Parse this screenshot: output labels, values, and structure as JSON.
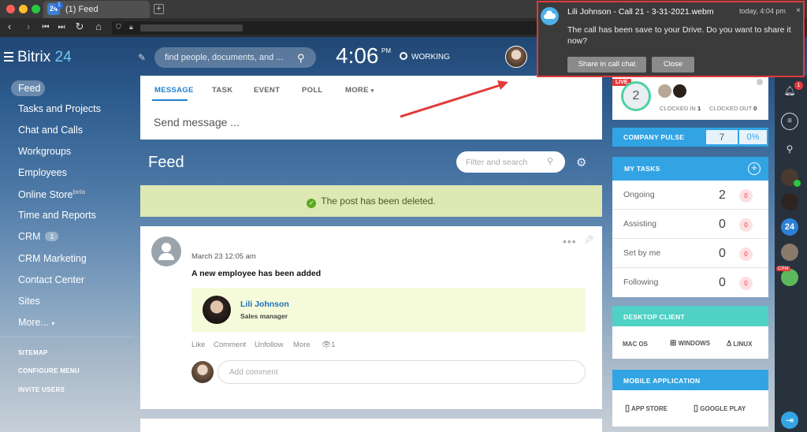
{
  "browser": {
    "tab_title": "(1) Feed",
    "tab_favicon_text": "24",
    "tab_badge": "1",
    "new_tab": "+"
  },
  "header": {
    "logo_main": "Bitrix",
    "logo_num": "24",
    "search_placeholder": "find people, documents, and ...",
    "clock": "4:06",
    "clock_pm": "PM",
    "status": "WORKING"
  },
  "sidebar": {
    "items": [
      {
        "label": "Feed"
      },
      {
        "label": "Tasks and Projects"
      },
      {
        "label": "Chat and Calls"
      },
      {
        "label": "Workgroups"
      },
      {
        "label": "Employees"
      },
      {
        "label": "Online Store",
        "sup": "beta"
      },
      {
        "label": "Time and Reports"
      },
      {
        "label": "CRM",
        "badge": "1"
      },
      {
        "label": "CRM Marketing"
      },
      {
        "label": "Contact Center"
      },
      {
        "label": "Sites"
      },
      {
        "label": "More..."
      }
    ],
    "small_links": [
      "SITEMAP",
      "CONFIGURE MENU",
      "INVITE USERS"
    ]
  },
  "composer": {
    "tabs": [
      "MESSAGE",
      "TASK",
      "EVENT",
      "POLL",
      "MORE"
    ],
    "placeholder": "Send message ..."
  },
  "feed": {
    "title": "Feed",
    "filter_placeholder": "Filter and search",
    "notice": "The post has been deleted.",
    "post": {
      "date": "March 23 12:05 am",
      "text": "A new employee has been added",
      "employee_name": "Lili Johnson",
      "employee_role": "Sales manager",
      "actions": [
        "Like",
        "Comment",
        "Unfollow",
        "More"
      ],
      "views": "1",
      "comment_placeholder": "Add comment"
    }
  },
  "right": {
    "live_tag": "LIVE",
    "live_count": "2",
    "clocked_in_label": "CLOCKED IN",
    "clocked_in": "1",
    "clocked_out_label": "CLOCKED OUT",
    "clocked_out": "0",
    "pulse_label": "COMPANY PULSE",
    "pulse_value": "7",
    "pulse_pct": "0%",
    "tasks_title": "MY TASKS",
    "tasks": [
      {
        "label": "Ongoing",
        "count": "2",
        "badge": "0"
      },
      {
        "label": "Assisting",
        "count": "0",
        "badge": "0"
      },
      {
        "label": "Set by me",
        "count": "0",
        "badge": "0"
      },
      {
        "label": "Following",
        "count": "0",
        "badge": "0"
      }
    ],
    "desktop_title": "DESKTOP CLIENT",
    "desktop_items": [
      "MAC OS",
      "WINDOWS",
      "LINUX"
    ],
    "mobile_title": "MOBILE APPLICATION",
    "mobile_items": [
      "APP STORE",
      "GOOGLE PLAY"
    ]
  },
  "rightbar": {
    "bell_badge": "1",
    "b24": "24",
    "crm_tag": "CRM"
  },
  "popup": {
    "title": "Lili Johnson - Call 21 - 3-31-2021.webm",
    "time": "today, 4:04 pm",
    "message": "The call has been save to your Drive. Do you want to share it now?",
    "share_button": "Share in call chat",
    "close_button": "Close"
  },
  "colors": {
    "accent": "#32a4e4",
    "teal": "#4fd1c5",
    "notice_bg": "#dde8b3",
    "popup_border": "#e23a3a",
    "annotation_arrow": "#e23a3a"
  }
}
